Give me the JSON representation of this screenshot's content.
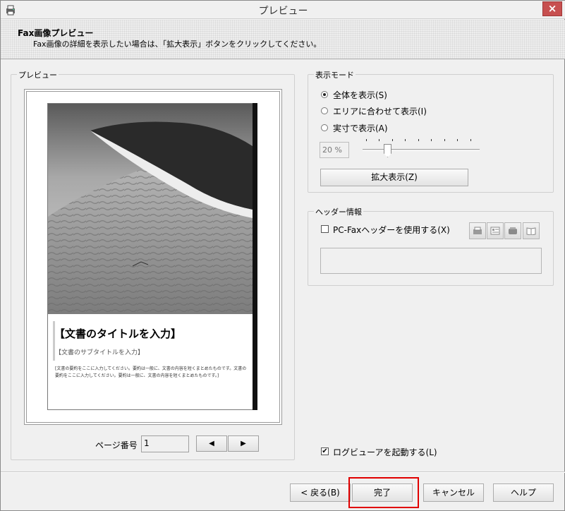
{
  "window": {
    "title": "プレビュー",
    "close_glyph": "×"
  },
  "header": {
    "title": "Fax画像プレビュー",
    "description": "Fax画像の詳細を表示したい場合は、「拡大表示」ボタンをクリックしてください。"
  },
  "preview": {
    "group_label": "プレビュー",
    "document": {
      "title": "【文書のタイトルを入力】",
      "subtitle": "【文書のサブタイトルを入力】",
      "body": "[文書の要約をここに入力してください。要約は一般に、文書の内容を短くまとめたものです。文書の要約をここに入力してください。要約は一般に、文書の内容を短くまとめたものです。]"
    },
    "page_label": "ページ番号",
    "page_value": "1",
    "prev_glyph": "◀",
    "next_glyph": "▶"
  },
  "display_mode": {
    "group_label": "表示モード",
    "options": [
      {
        "label": "全体を表示(S)",
        "selected": true
      },
      {
        "label": "エリアに合わせて表示(I)",
        "selected": false
      },
      {
        "label": "実寸で表示(A)",
        "selected": false
      }
    ],
    "zoom_value": "20 %",
    "zoom_slider_fraction": 0.2,
    "zoom_button": "拡大表示(Z)"
  },
  "header_info": {
    "group_label": "ヘッダー情報",
    "use_header_label": "PC-Faxヘッダーを使用する(X)",
    "use_header_checked": false,
    "icons": [
      "fax-machine-icon",
      "list-card-icon",
      "phone-icon",
      "address-book-icon"
    ],
    "header_text": ""
  },
  "log_viewer": {
    "label": "ログビューアを起動する(L)",
    "checked": true
  },
  "buttons": {
    "back": "< 戻る(B)",
    "finish": "完了",
    "cancel": "キャンセル",
    "help": "ヘルプ"
  },
  "colors": {
    "highlight": "#e10000",
    "close_button": "#c75050"
  }
}
